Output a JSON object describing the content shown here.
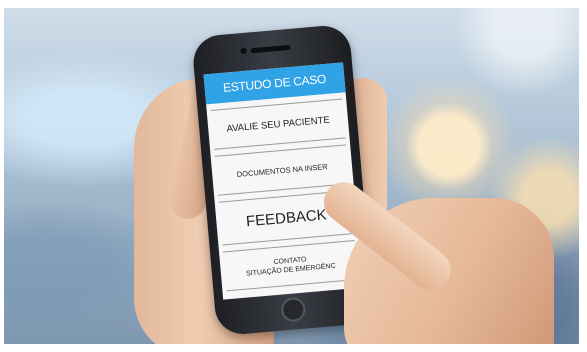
{
  "app": {
    "header_title": "ESTUDO DE CASO",
    "menu": [
      {
        "label": "AVALIE SEU PACIENTE"
      },
      {
        "label": "DOCUMENTOS NA INSER"
      },
      {
        "label": "FEEDBACK"
      },
      {
        "label_line1": "CONTATO",
        "label_line2": "SITUAÇÃO DE EMERGÊNC"
      }
    ]
  },
  "colors": {
    "header_bg": "#2fa3e6",
    "screen_bg": "#f7f7f7",
    "phone_body": "#2a2c31"
  }
}
